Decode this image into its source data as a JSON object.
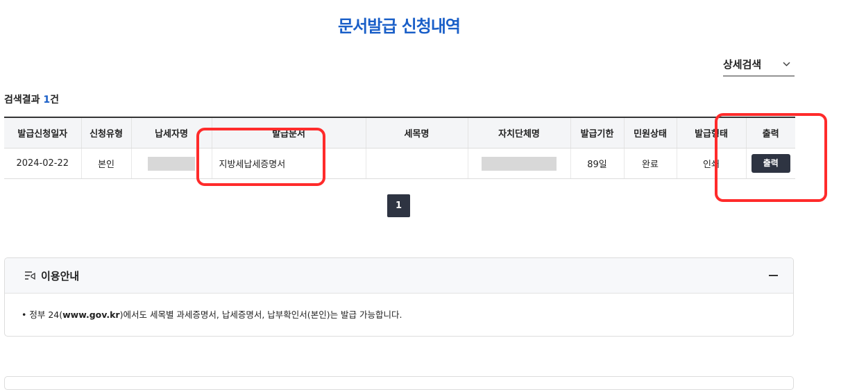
{
  "page": {
    "title": "문서발급 신청내역"
  },
  "search": {
    "detail_label": "상세검색",
    "chevron": "⌄"
  },
  "results": {
    "prefix": "검색결과 ",
    "count": "1",
    "suffix": "건"
  },
  "table": {
    "headers": [
      "발급신청일자",
      "신청유형",
      "납세자명",
      "발급문서",
      "세목명",
      "자치단체명",
      "발급기한",
      "민원상태",
      "발급형태",
      "출력"
    ],
    "rows": [
      {
        "date": "2024-02-22",
        "type": "본인",
        "doc": "지방세납세증명서",
        "tax": "",
        "gov_prefix": "",
        "deadline": "89일",
        "status": "완료",
        "form": "인쇄",
        "print_label": "출력"
      }
    ]
  },
  "pagination": {
    "current": "1"
  },
  "guide": {
    "title": "이용안내",
    "collapse_icon": "minus-icon",
    "item_prefix": "• 정부 24(",
    "item_url": "www.gov.kr",
    "item_suffix": ")에서도 세목별 과세증명서, 납세증명서, 납부확인서(본인)는 발급 가능합니다."
  },
  "colors": {
    "brand": "#1a5fc8",
    "button_dark": "#2e3442",
    "highlight": "#ff2b2b"
  }
}
